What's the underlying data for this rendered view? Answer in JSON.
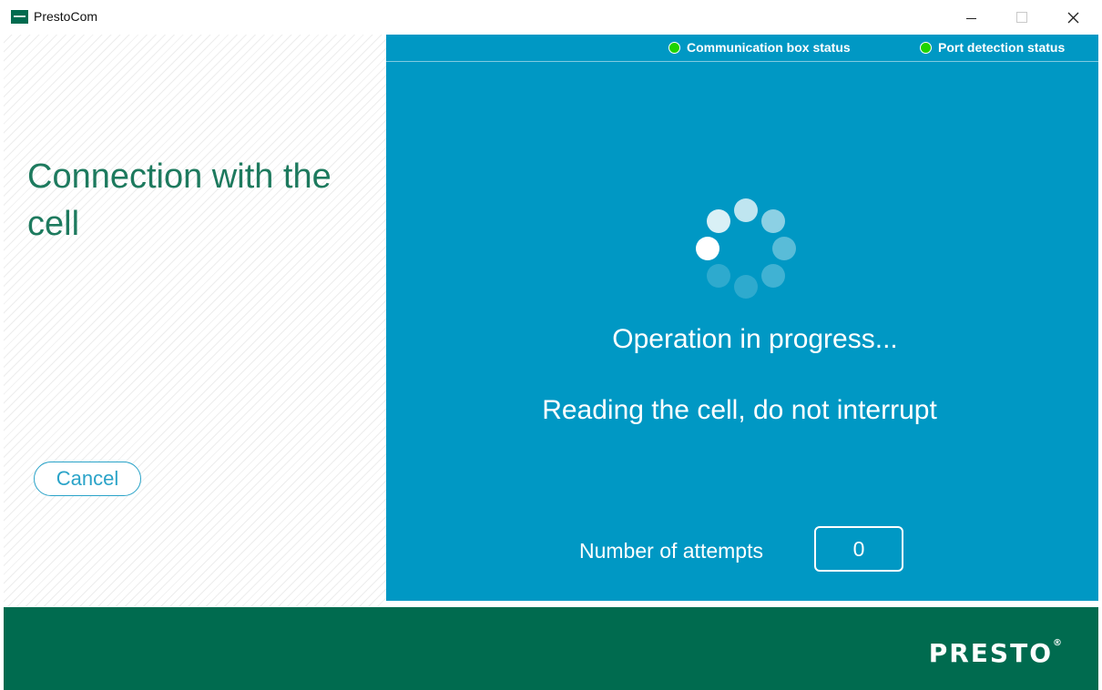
{
  "window": {
    "title": "PrestoCom",
    "controls": {
      "minimize_icon": "minimize-icon",
      "maximize_icon": "maximize-icon",
      "close_icon": "close-icon"
    }
  },
  "left_panel": {
    "title": "Connection with the cell",
    "cancel_label": "Cancel"
  },
  "status_bar": {
    "items": [
      {
        "label": "Communication box status",
        "state_color": "#1fd400"
      },
      {
        "label": "Port detection status",
        "state_color": "#1fd400"
      }
    ]
  },
  "main": {
    "spinner_icon": "loading-spinner-icon",
    "operation_text": "Operation in progress...",
    "detail_text": "Reading the cell, do not interrupt",
    "attempts_label": "Number of attempts",
    "attempts_value": "0"
  },
  "footer": {
    "brand": "PRESTO",
    "brand_mark": "®"
  },
  "colors": {
    "accent_green": "#006b4f",
    "title_green": "#1d7a5e",
    "panel_blue": "#0098c4",
    "cancel_blue": "#2aa3c8"
  }
}
